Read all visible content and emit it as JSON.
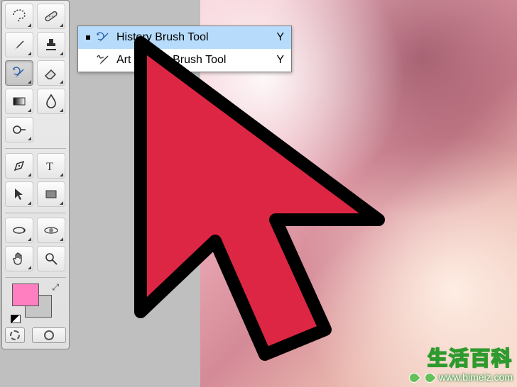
{
  "toolbox": {
    "tools": [
      {
        "name": "lasso-tool",
        "icon": "lasso"
      },
      {
        "name": "healing-brush-tool",
        "icon": "bandaid"
      },
      {
        "name": "brush-tool",
        "icon": "brush"
      },
      {
        "name": "clone-stamp-tool",
        "icon": "stamp"
      },
      {
        "name": "history-brush-tool",
        "icon": "historybrush",
        "active": true
      },
      {
        "name": "eraser-tool",
        "icon": "eraser"
      },
      {
        "name": "gradient-tool",
        "icon": "gradient"
      },
      {
        "name": "blur-tool",
        "icon": "droplet"
      },
      {
        "name": "dodge-tool",
        "icon": "dodge"
      },
      {
        "name": "pen-tool",
        "icon": "pen"
      },
      {
        "name": "type-tool",
        "icon": "type"
      },
      {
        "name": "path-selection-tool",
        "icon": "arrow"
      },
      {
        "name": "rectangle-tool",
        "icon": "rect"
      },
      {
        "name": "3d-rotate-tool",
        "icon": "rotate3d"
      },
      {
        "name": "3d-orbit-tool",
        "icon": "orbit"
      },
      {
        "name": "hand-tool",
        "icon": "hand"
      },
      {
        "name": "zoom-tool",
        "icon": "zoom"
      }
    ],
    "foreground_color": "#ff7fc0",
    "background_color": "#c6c6c6"
  },
  "flyout": {
    "items": [
      {
        "label": "History Brush Tool",
        "shortcut": "Y",
        "icon": "historybrush",
        "selected": true
      },
      {
        "label": "Art History Brush Tool",
        "shortcut": "Y",
        "icon": "arthistory",
        "selected": false
      }
    ]
  },
  "watermark": {
    "title": "生活百科",
    "url": "www.bimeiz.com"
  }
}
